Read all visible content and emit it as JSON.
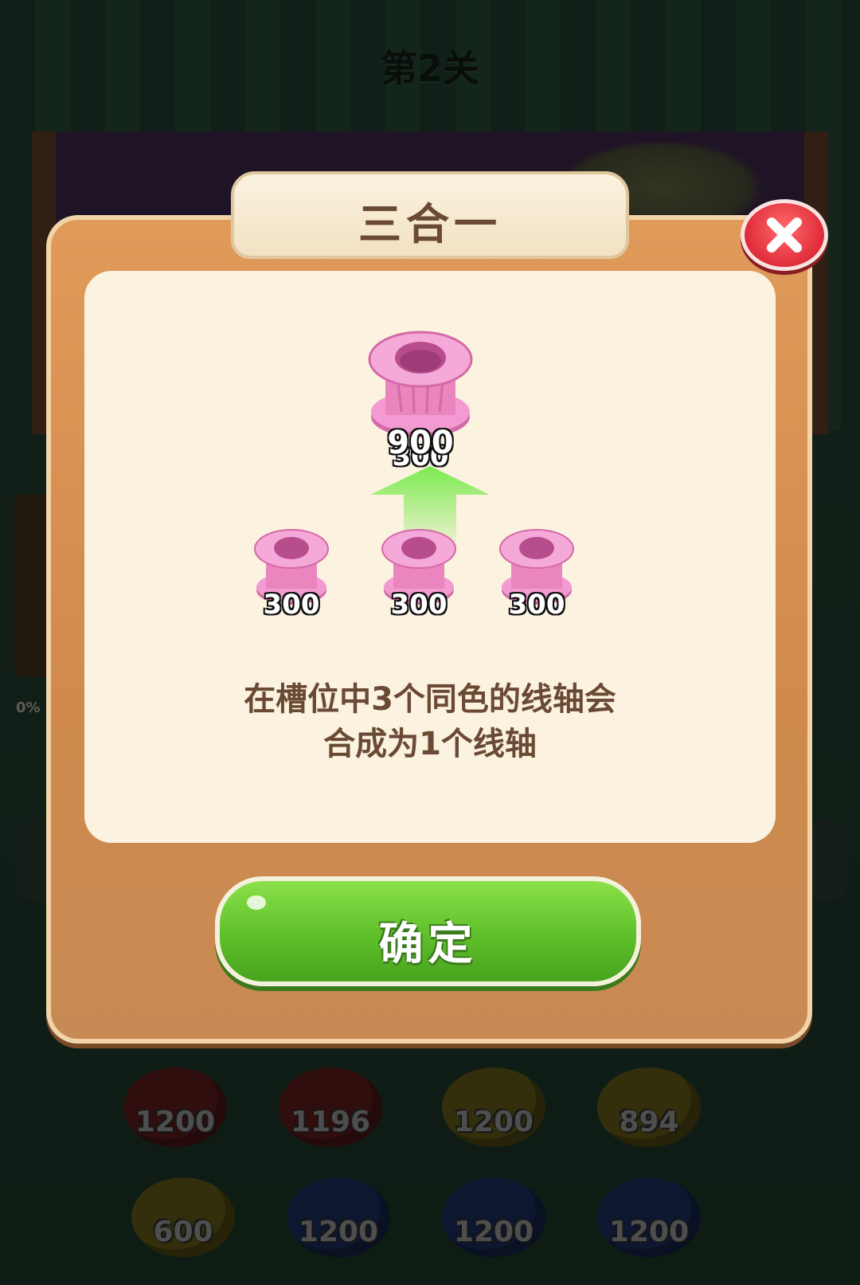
{
  "level": {
    "title": "第2关"
  },
  "background": {
    "progress_text": "0%"
  },
  "modal": {
    "title": "三合一",
    "result_spool": {
      "value_top": "900",
      "value_under": "300",
      "color": "#f29ad1"
    },
    "source_spools": [
      {
        "value": "300",
        "color": "#f29ad1"
      },
      {
        "value": "300",
        "color": "#f29ad1"
      },
      {
        "value": "300",
        "color": "#f29ad1"
      }
    ],
    "description_line1": "在槽位中3个同色的线轴会",
    "description_line2": "合成为1个线轴",
    "confirm_label": "确定"
  },
  "spool_tray": [
    {
      "value": "1200",
      "color": "#5a1a1a"
    },
    {
      "value": "1196",
      "color": "#5a1a1a"
    },
    {
      "value": "1200",
      "color": "#5d5618"
    },
    {
      "value": "894",
      "color": "#5d5618"
    },
    {
      "value": "600",
      "color": "#5d5618"
    },
    {
      "value": "1200",
      "color": "#182a57"
    },
    {
      "value": "1200",
      "color": "#182a57"
    },
    {
      "value": "1200",
      "color": "#182a57"
    }
  ]
}
